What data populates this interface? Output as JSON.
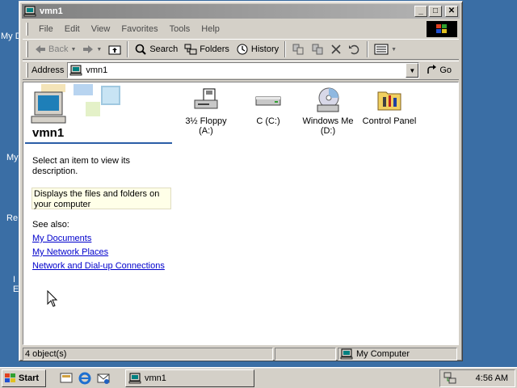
{
  "desktop": {
    "labels": [
      "My D",
      "My",
      "Re",
      "I",
      "E"
    ]
  },
  "window": {
    "title": "vmn1",
    "buttons": {
      "minimize": "_",
      "maximize": "□",
      "close": "✕"
    }
  },
  "menu": [
    "File",
    "Edit",
    "View",
    "Favorites",
    "Tools",
    "Help"
  ],
  "toolbar": {
    "back": "Back",
    "search": "Search",
    "folders": "Folders",
    "history": "History"
  },
  "address": {
    "label": "Address",
    "value": "vmn1",
    "go": "Go"
  },
  "sidebar": {
    "title": "vmn1",
    "instruction": "Select an item to view its description.",
    "description": "Displays the files and folders on your computer",
    "see_also": "See also:",
    "links": [
      "My Documents",
      "My Network Places",
      "Network and Dial-up Connections"
    ]
  },
  "drives": [
    {
      "label": "3½ Floppy (A:)",
      "icon": "floppy-drive-icon"
    },
    {
      "label": "C (C:)",
      "icon": "hard-disk-icon"
    },
    {
      "label": "Windows Me (D:)",
      "icon": "cd-drive-icon"
    },
    {
      "label": "Control Panel",
      "icon": "control-panel-icon"
    }
  ],
  "status": {
    "count": "4 object(s)",
    "location": "My Computer"
  },
  "taskbar": {
    "start": "Start",
    "task": "vmn1",
    "clock": "4:56 AM"
  },
  "colors": {
    "desktop": "#3a6ea5",
    "title_inactive": "#808080",
    "link": "#0000cc",
    "face": "#d4d0c8"
  }
}
